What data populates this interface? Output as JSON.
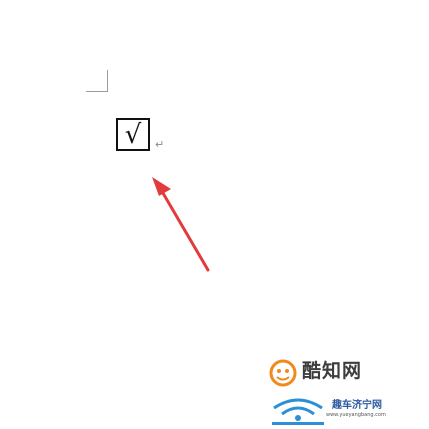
{
  "document": {
    "checkbox_symbol": "√",
    "paragraph_mark": "↵"
  },
  "annotation": {
    "arrow_color": "#e23b3b"
  },
  "watermark": {
    "brand_text": "酷知网",
    "site_name": "趣车济宁网",
    "url": "www.yueyangbang.com",
    "logo_icon": "brand-logo-icon",
    "brand_color": "#f08a1c",
    "site_color": "#2c5aa0"
  }
}
